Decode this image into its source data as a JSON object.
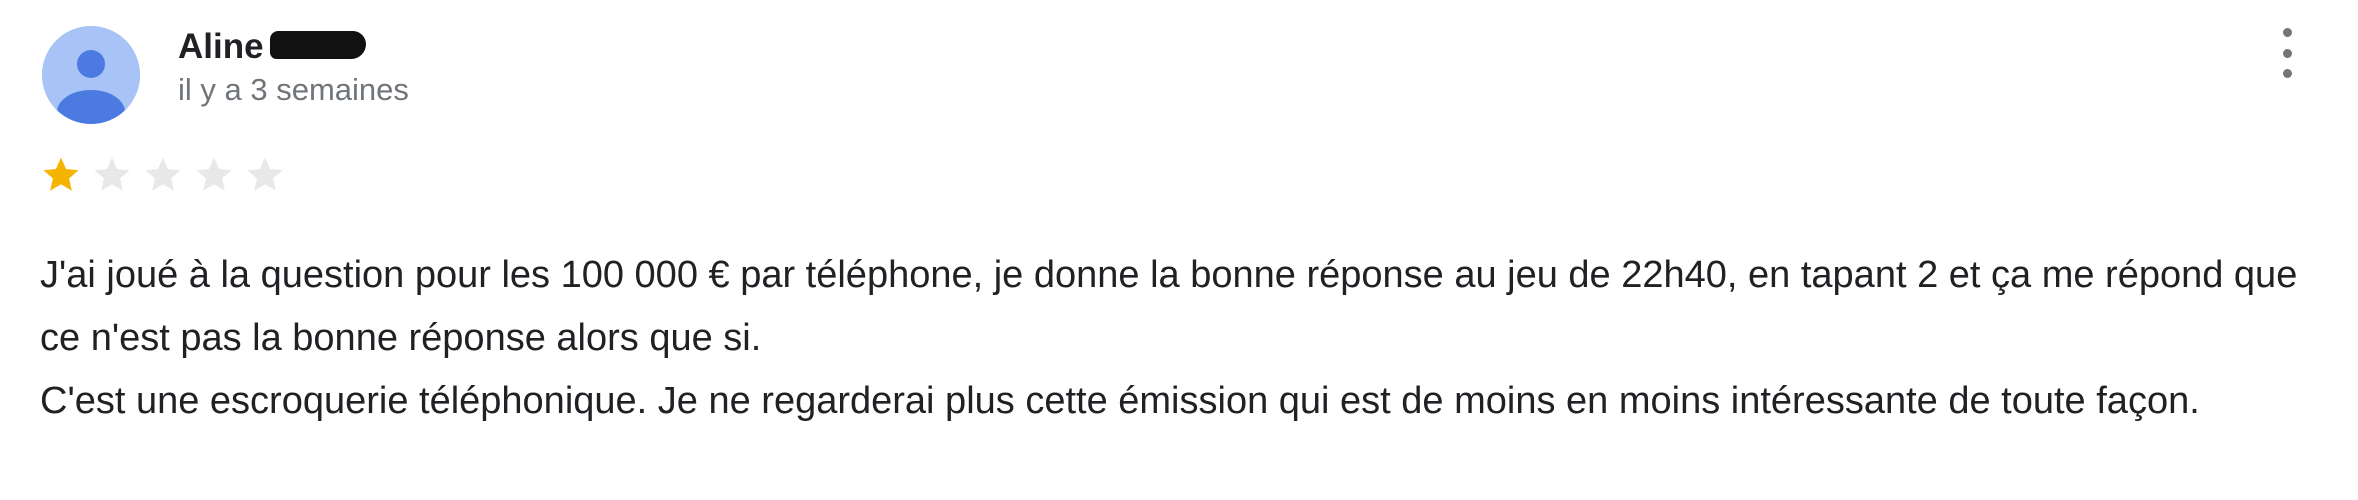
{
  "author": {
    "name": "Aline",
    "timestamp": "il y a 3 semaines"
  },
  "rating": {
    "value": 1,
    "max": 5,
    "filled_color": "#f4b400",
    "empty_color": "#e8e8e8"
  },
  "review": {
    "paragraphs": [
      "J'ai joué à la question pour les 100 000 € par téléphone, je donne la bonne réponse au jeu de 22h40, en tapant 2 et ça me répond que ce n'est pas la bonne réponse alors que si.",
      "C'est une escroquerie téléphonique. Je ne regarderai plus cette émission qui est de moins en moins intéressante de toute façon."
    ]
  },
  "icons": {
    "avatar": "default-avatar-icon",
    "menu": "more-vertical-icon",
    "star": "star-icon"
  },
  "colors": {
    "avatar_bg": "#a8c3f5",
    "avatar_fg": "#4b7be0"
  }
}
